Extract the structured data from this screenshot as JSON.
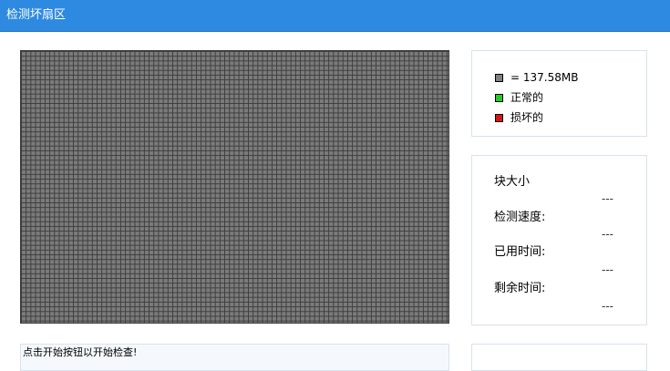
{
  "window": {
    "title": "检测坏扇区"
  },
  "legend": {
    "items": [
      {
        "text": "= 137.58MB",
        "color": "#808080"
      },
      {
        "text": "正常的",
        "color": "#22cc22"
      },
      {
        "text": "损坏的",
        "color": "#dd1111"
      }
    ]
  },
  "stats": {
    "block_size_label": "块大小",
    "block_size_value": "---",
    "speed_label": "检测速度:",
    "speed_value": "---",
    "elapsed_label": "已用时间:",
    "elapsed_value": "---",
    "remaining_label": "剩余时间:",
    "remaining_value": "---"
  },
  "status": {
    "message": "点击开始按钮以开始检查!"
  }
}
